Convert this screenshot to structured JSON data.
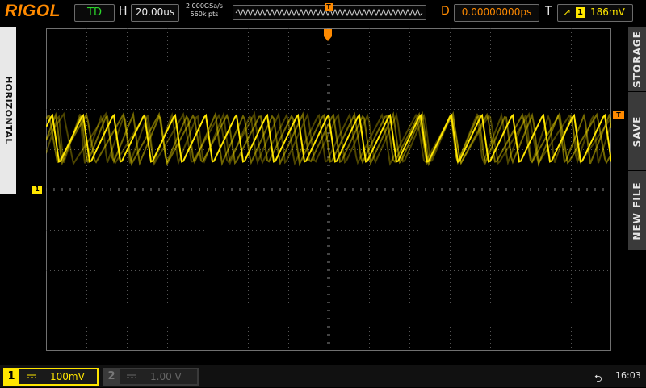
{
  "header": {
    "logo": "RIGOL",
    "run_status": "TD",
    "h_label": "H",
    "timebase": "20.00us",
    "sample_rate": "2.000GSa/s",
    "memory_depth": "560k pts",
    "d_label": "D",
    "trigger_delay": "0.00000000ps",
    "t_label": "T",
    "trigger_channel": "1",
    "trigger_level": "186mV"
  },
  "left_menu": {
    "label": "HORIZONTAL"
  },
  "right_menu": {
    "items": [
      {
        "label": "STORAGE"
      },
      {
        "label": "SAVE"
      },
      {
        "label": "NEW FILE"
      }
    ]
  },
  "markers": {
    "channel1": "1",
    "trigger": "T",
    "trigger_pos": "T"
  },
  "channels": [
    {
      "number": "1",
      "scale": "100mV",
      "enabled": true
    },
    {
      "number": "2",
      "scale": "1.00 V",
      "enabled": false
    }
  ],
  "status": {
    "time": "16:03"
  },
  "colors": {
    "ch1": "#ffe600",
    "brand": "#ff8a00",
    "status_green": "#2bd82b"
  }
}
